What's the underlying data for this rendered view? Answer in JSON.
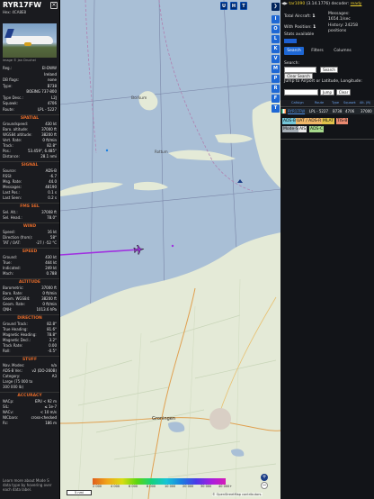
{
  "aircraft": {
    "callsign": "RYR17FW",
    "hex_label": "Hex: 4CA8E8",
    "photo_credit": "image © Jan Druchel",
    "fields": [
      {
        "k": "Reg.:",
        "v": "EI-DWW"
      },
      {
        "k": "",
        "v": "Ireland"
      },
      {
        "k": "DB flags:",
        "v": "none"
      },
      {
        "k": "Type:",
        "v": "B738"
      },
      {
        "k": "",
        "v": "BOEING 737-800"
      },
      {
        "k": "Type Desc.:",
        "v": "L2J"
      },
      {
        "k": "Squawk:",
        "v": "4706"
      },
      {
        "k": "Route:",
        "v": "LPL - 5227"
      }
    ],
    "sections": [
      {
        "title": "SPATIAL",
        "rows": [
          {
            "k": "Groundspeed:",
            "v": "430 kt"
          },
          {
            "k": "Baro. altitude:",
            "v": "37000 ft"
          },
          {
            "k": "WGS84 altitude:",
            "v": "38200 ft"
          },
          {
            "k": "Vert. Rate:",
            "v": "0 ft/min"
          },
          {
            "k": "Track:",
            "v": "82.8°"
          },
          {
            "k": "Pos.:",
            "v": "53.459°, 6.485°"
          },
          {
            "k": "Distance:",
            "v": "28.1 nmi"
          }
        ]
      },
      {
        "title": "SIGNAL",
        "rows": [
          {
            "k": "Source:",
            "v": "ADS-B"
          },
          {
            "k": "RSSI:",
            "v": "-6.7"
          },
          {
            "k": "Msg. Rate:",
            "v": "44.0"
          },
          {
            "k": "Messages:",
            "v": "48190"
          },
          {
            "k": "Last Pos.:",
            "v": "0.1 s"
          },
          {
            "k": "Last Seen:",
            "v": "0.2 s"
          }
        ]
      },
      {
        "title": "FMS SEL",
        "rows": [
          {
            "k": "Sel. Alt.:",
            "v": "37008 ft"
          },
          {
            "k": "Sel. Head.:",
            "v": "78.0°"
          }
        ]
      },
      {
        "title": "WIND",
        "rows": [
          {
            "k": "Speed:",
            "v": "16 kt"
          },
          {
            "k": "Direction (from):",
            "v": "58°"
          },
          {
            "k": "TAT / OAT:",
            "v": "-27 / -52 °C"
          }
        ]
      },
      {
        "title": "SPEED",
        "rows": [
          {
            "k": "Ground:",
            "v": "430 kt"
          },
          {
            "k": "True:",
            "v": "444 kt"
          },
          {
            "k": "Indicated:",
            "v": "249 kt"
          },
          {
            "k": "Mach:",
            "v": "0.788"
          }
        ]
      },
      {
        "title": "ALTITUDE",
        "rows": [
          {
            "k": "Barometric:",
            "v": "37000 ft"
          },
          {
            "k": "Baro. Rate:",
            "v": "0 ft/min"
          },
          {
            "k": "Geom. WGS84:",
            "v": "38200 ft"
          },
          {
            "k": "Geom. Rate:",
            "v": "0 ft/min"
          },
          {
            "k": "QNH:",
            "v": "1013.6 hPa"
          }
        ]
      },
      {
        "title": "DIRECTION",
        "rows": [
          {
            "k": "Ground Track:",
            "v": "82.8°"
          },
          {
            "k": "True Heading:",
            "v": "81.6°"
          },
          {
            "k": "Magnetic Heading:",
            "v": "78.8°"
          },
          {
            "k": "Magnetic Decl.:",
            "v": "3.2°"
          },
          {
            "k": "Track Rate:",
            "v": "0.00"
          },
          {
            "k": "Roll:",
            "v": "-0.5°"
          }
        ]
      },
      {
        "title": "STUFF",
        "rows": [
          {
            "k": "Nav. Modes:",
            "v": "n/a"
          },
          {
            "k": "ADS-B Ver.:",
            "v": "v2 (DO-260B)"
          },
          {
            "k": "Category:",
            "v": "A3"
          },
          {
            "k": "Large (75 000 to",
            "v": ""
          },
          {
            "k": "300 000 lb)",
            "v": ""
          }
        ]
      },
      {
        "title": "ACCURACY",
        "rows": [
          {
            "k": "NACp:",
            "v": "EPU < 92 m"
          },
          {
            "k": "SIL:",
            "v": "≤ 1e-7"
          },
          {
            "k": "NACv:",
            "v": "< 10 m/s"
          },
          {
            "k": "NICbaro:",
            "v": "cross-checked"
          },
          {
            "k": "Rc:",
            "v": "186 m"
          }
        ]
      }
    ],
    "footer": "Learn more about Mode S data type by hovering over each data label."
  },
  "map": {
    "top_buttons": [
      "U",
      "H",
      "T"
    ],
    "place_labels": [
      {
        "text": "Borkum",
        "cls": "island"
      },
      {
        "text": "Rottum",
        "cls": "island"
      },
      {
        "text": "Groningen",
        "cls": "city"
      }
    ],
    "scale_label": "5 nmi",
    "alt_ticks": [
      "2 000",
      "4 000",
      "6 000",
      "8 000",
      "10 000",
      "20 000",
      "30 000",
      "40 000+"
    ],
    "attribution": "© OpenStreetMap contributors.",
    "zoom_in": "+",
    "zoom_out": "−"
  },
  "rail": {
    "top": "❯",
    "buttons": [
      "I",
      "O",
      "L",
      "K",
      "V",
      "M",
      "P",
      "R",
      "F",
      "T"
    ]
  },
  "panel": {
    "version_link": "tar1090",
    "version_text": "(3.14.1776) decoder:",
    "version_status": "ready",
    "total_aircraft_label": "Total Aircraft:",
    "total_aircraft": "1",
    "with_position_label": "With Position:",
    "with_position": "1",
    "messages_label": "Messages:",
    "messages": "1654.1/sec",
    "history_label": "History:",
    "history": "24258 positions",
    "stats_label": "Stats available",
    "tabs": [
      "Search",
      "Filters",
      "Columns"
    ],
    "search_label": "Search:",
    "search_button": "Search",
    "clear_search_button": "Clear Search",
    "jump_label": "Jump to Airport or Latitude, Longitude:",
    "jump_button": "Jump",
    "clear_button": "Clear",
    "table_headers": [
      "Callsign",
      "Route",
      "Type",
      "Squawk",
      "Alt. (ft)"
    ],
    "table_rows": [
      {
        "callsign": "RYR17FW",
        "route": "LPL - 5227",
        "type": "B738",
        "squawk": "4706",
        "alt": "37000"
      }
    ],
    "legend": [
      {
        "label": "ADS-B",
        "color": "#75c7d9"
      },
      {
        "label": "UAT / ADS-R",
        "color": "#f1b86a"
      },
      {
        "label": "MLAT",
        "color": "#e0c24a"
      },
      {
        "label": "TIS-B",
        "color": "#e98a70"
      },
      {
        "label": "Mode-S",
        "color": "#a7b0b8"
      },
      {
        "label": "AIS",
        "color": "#e9e9e9"
      },
      {
        "label": "ADS-C",
        "color": "#a6d98c"
      }
    ]
  }
}
